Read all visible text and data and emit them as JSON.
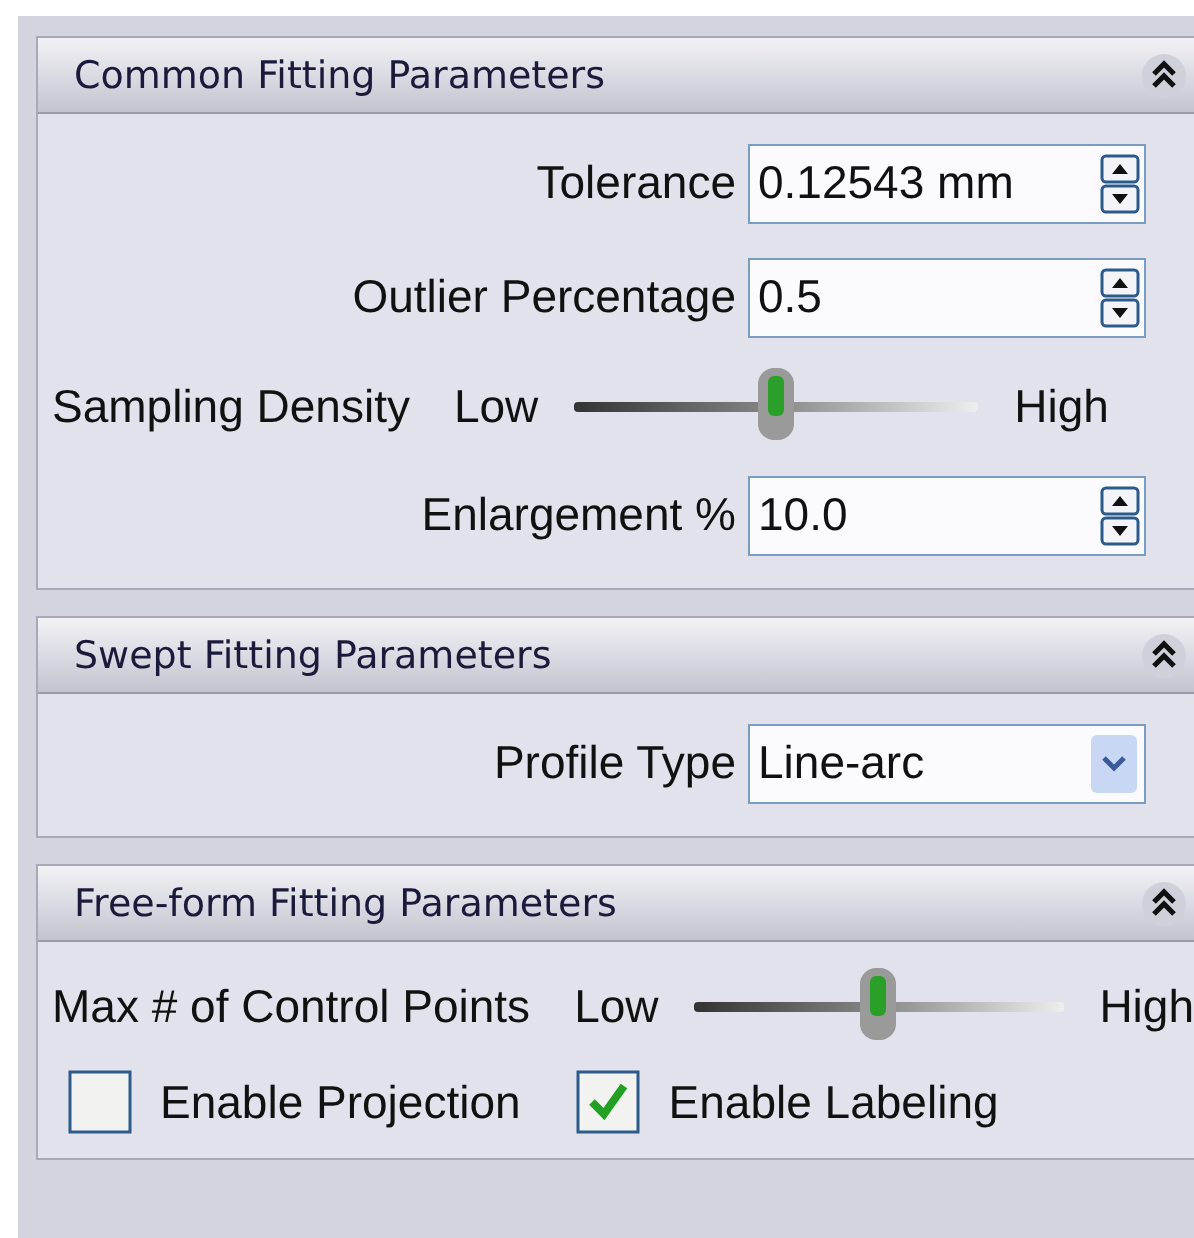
{
  "sections": [
    {
      "title": "Common Fitting Parameters",
      "expanded": true,
      "rows": [
        {
          "kind": "spin",
          "label": "Tolerance",
          "value": "0.12543 mm"
        },
        {
          "kind": "spin",
          "label": "Outlier Percentage",
          "value": "0.5"
        },
        {
          "kind": "slider",
          "label": "Sampling Density",
          "low": "Low",
          "high": "High",
          "level": 0.5
        },
        {
          "kind": "spin",
          "label": "Enlargement %",
          "value": "10.0"
        }
      ]
    },
    {
      "title": "Swept Fitting Parameters",
      "expanded": true,
      "rows": [
        {
          "kind": "dropdown",
          "label": "Profile Type",
          "value": "Line-arc"
        }
      ]
    },
    {
      "title": "Free-form Fitting Parameters",
      "expanded": true,
      "rows": [
        {
          "kind": "slider",
          "label": "Max # of Control Points",
          "low": "Low",
          "high": "High",
          "level": 0.5
        },
        {
          "kind": "checks",
          "items": [
            {
              "label": "Enable Projection",
              "checked": false
            },
            {
              "label": "Enable Labeling",
              "checked": true
            }
          ]
        }
      ]
    }
  ]
}
